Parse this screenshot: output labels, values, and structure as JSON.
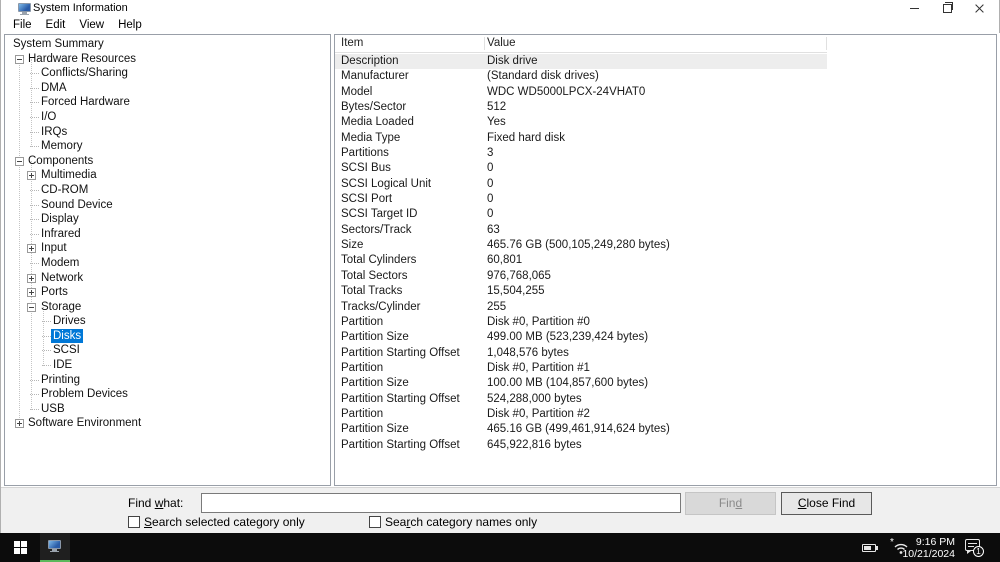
{
  "titlebar": {
    "title": "System Information"
  },
  "menubar": {
    "items": [
      "File",
      "Edit",
      "View",
      "Help"
    ]
  },
  "tree": {
    "items": [
      {
        "label": "System Summary",
        "level": 0,
        "expander": null,
        "selected": false
      },
      {
        "label": "Hardware Resources",
        "level": 1,
        "expander": "minus",
        "selected": false
      },
      {
        "label": "Conflicts/Sharing",
        "level": 2,
        "expander": null,
        "selected": false
      },
      {
        "label": "DMA",
        "level": 2,
        "expander": null,
        "selected": false
      },
      {
        "label": "Forced Hardware",
        "level": 2,
        "expander": null,
        "selected": false
      },
      {
        "label": "I/O",
        "level": 2,
        "expander": null,
        "selected": false
      },
      {
        "label": "IRQs",
        "level": 2,
        "expander": null,
        "selected": false
      },
      {
        "label": "Memory",
        "level": 2,
        "expander": null,
        "selected": false
      },
      {
        "label": "Components",
        "level": 1,
        "expander": "minus",
        "selected": false
      },
      {
        "label": "Multimedia",
        "level": 2,
        "expander": "plus",
        "selected": false
      },
      {
        "label": "CD-ROM",
        "level": 2,
        "expander": null,
        "selected": false
      },
      {
        "label": "Sound Device",
        "level": 2,
        "expander": null,
        "selected": false
      },
      {
        "label": "Display",
        "level": 2,
        "expander": null,
        "selected": false
      },
      {
        "label": "Infrared",
        "level": 2,
        "expander": null,
        "selected": false
      },
      {
        "label": "Input",
        "level": 2,
        "expander": "plus",
        "selected": false
      },
      {
        "label": "Modem",
        "level": 2,
        "expander": null,
        "selected": false
      },
      {
        "label": "Network",
        "level": 2,
        "expander": "plus",
        "selected": false
      },
      {
        "label": "Ports",
        "level": 2,
        "expander": "plus",
        "selected": false
      },
      {
        "label": "Storage",
        "level": 2,
        "expander": "minus",
        "selected": false
      },
      {
        "label": "Drives",
        "level": 3,
        "expander": null,
        "selected": false
      },
      {
        "label": "Disks",
        "level": 3,
        "expander": null,
        "selected": true
      },
      {
        "label": "SCSI",
        "level": 3,
        "expander": null,
        "selected": false
      },
      {
        "label": "IDE",
        "level": 3,
        "expander": null,
        "selected": false
      },
      {
        "label": "Printing",
        "level": 2,
        "expander": null,
        "selected": false
      },
      {
        "label": "Problem Devices",
        "level": 2,
        "expander": null,
        "selected": false
      },
      {
        "label": "USB",
        "level": 2,
        "expander": null,
        "selected": false
      },
      {
        "label": "Software Environment",
        "level": 1,
        "expander": "plus",
        "selected": false
      }
    ]
  },
  "table": {
    "columns": [
      "Item",
      "Value"
    ],
    "rows": [
      {
        "item": "Description",
        "value": "Disk drive",
        "selected": true
      },
      {
        "item": "Manufacturer",
        "value": "(Standard disk drives)",
        "selected": false
      },
      {
        "item": "Model",
        "value": "WDC WD5000LPCX-24VHAT0",
        "selected": false
      },
      {
        "item": "Bytes/Sector",
        "value": "512",
        "selected": false
      },
      {
        "item": "Media Loaded",
        "value": "Yes",
        "selected": false
      },
      {
        "item": "Media Type",
        "value": "Fixed hard disk",
        "selected": false
      },
      {
        "item": "Partitions",
        "value": "3",
        "selected": false
      },
      {
        "item": "SCSI Bus",
        "value": "0",
        "selected": false
      },
      {
        "item": "SCSI Logical Unit",
        "value": "0",
        "selected": false
      },
      {
        "item": "SCSI Port",
        "value": "0",
        "selected": false
      },
      {
        "item": "SCSI Target ID",
        "value": "0",
        "selected": false
      },
      {
        "item": "Sectors/Track",
        "value": "63",
        "selected": false
      },
      {
        "item": "Size",
        "value": "465.76 GB (500,105,249,280 bytes)",
        "selected": false
      },
      {
        "item": "Total Cylinders",
        "value": "60,801",
        "selected": false
      },
      {
        "item": "Total Sectors",
        "value": "976,768,065",
        "selected": false
      },
      {
        "item": "Total Tracks",
        "value": "15,504,255",
        "selected": false
      },
      {
        "item": "Tracks/Cylinder",
        "value": "255",
        "selected": false
      },
      {
        "item": "Partition",
        "value": "Disk #0, Partition #0",
        "selected": false
      },
      {
        "item": "Partition Size",
        "value": "499.00 MB (523,239,424 bytes)",
        "selected": false
      },
      {
        "item": "Partition Starting Offset",
        "value": "1,048,576 bytes",
        "selected": false
      },
      {
        "item": "Partition",
        "value": "Disk #0, Partition #1",
        "selected": false
      },
      {
        "item": "Partition Size",
        "value": "100.00 MB (104,857,600 bytes)",
        "selected": false
      },
      {
        "item": "Partition Starting Offset",
        "value": "524,288,000 bytes",
        "selected": false
      },
      {
        "item": "Partition",
        "value": "Disk #0, Partition #2",
        "selected": false
      },
      {
        "item": "Partition Size",
        "value": "465.16 GB (499,461,914,624 bytes)",
        "selected": false
      },
      {
        "item": "Partition Starting Offset",
        "value": "645,922,816 bytes",
        "selected": false
      }
    ]
  },
  "findbar": {
    "label": {
      "pre": "Find ",
      "accel": "w",
      "post": "hat:"
    },
    "input_value": "",
    "find_button": {
      "pre": "Fin",
      "accel": "d",
      "post": ""
    },
    "close_button": {
      "pre": "",
      "accel": "C",
      "post": "lose Find"
    },
    "checkbox_selected_category": {
      "pre": "",
      "accel": "S",
      "post": "earch selected category only",
      "checked": false
    },
    "checkbox_category_names": {
      "pre": "Sea",
      "accel": "r",
      "post": "ch category names only",
      "checked": false
    }
  },
  "taskbar": {
    "time": "9:16 PM",
    "date": "10/21/2024",
    "notification_badge": "1"
  },
  "colors": {
    "selection_blue": "#0078d7",
    "inactive_row_selection": "#ededed",
    "taskbar_bg": "#0c0c0c",
    "active_app_underline": "#5bb85b",
    "findbar_bg": "#f0f0f0"
  }
}
